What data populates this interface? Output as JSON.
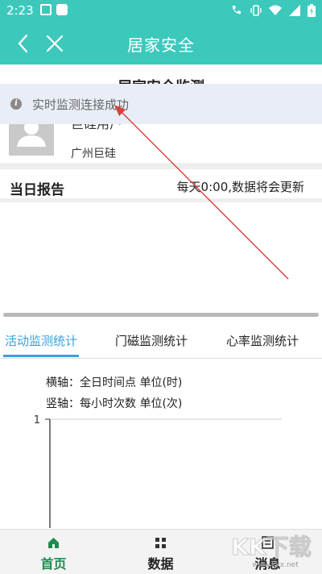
{
  "status_bar": {
    "time": "2:23"
  },
  "nav": {
    "title": "居家安全"
  },
  "profile": {
    "page_heading": "居家安全监测",
    "name": "巨硅用户",
    "company": "广州巨硅"
  },
  "toast": {
    "message": "实时监测连接成功"
  },
  "report": {
    "title": "当日报告",
    "note": "每天0:00,数据将会更新"
  },
  "tabs": [
    {
      "label": "活动监测统计",
      "active": true
    },
    {
      "label": "门磁监测统计",
      "active": false
    },
    {
      "label": "心率监测统计",
      "active": false
    }
  ],
  "chart_data": {
    "type": "bar",
    "x_axis_note": "横轴：全日时间点 单位(时)",
    "y_axis_note": "竖轴：每小时次数 单位(次)",
    "y_tick_labels": [
      "1"
    ],
    "ylim": [
      0,
      1
    ],
    "categories": [],
    "values": []
  },
  "bottom_nav": [
    {
      "label": "首页",
      "icon": "home-icon",
      "active": true
    },
    {
      "label": "数据",
      "icon": "grid-icon",
      "active": false
    },
    {
      "label": "消息",
      "icon": "message-icon",
      "active": false
    }
  ],
  "watermark": {
    "text": "KK下载",
    "url": "www.kkx.net"
  },
  "colors": {
    "accent": "#3cc9bc",
    "tab_active": "#3a9fe0",
    "nav_active": "#1e8a4f",
    "annotation": "#d9403a"
  }
}
